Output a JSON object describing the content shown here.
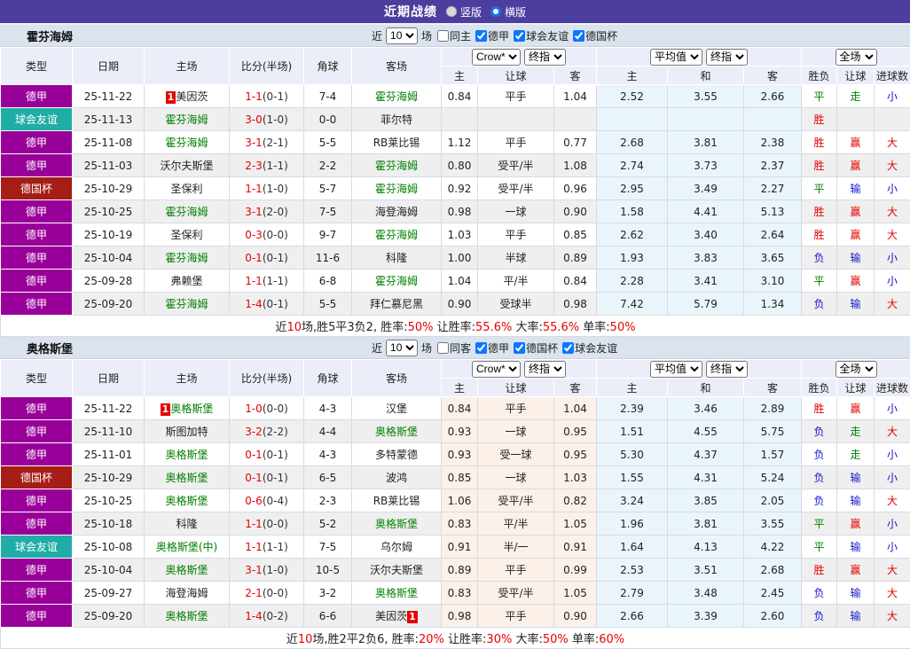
{
  "topbar": {
    "title": "近期战绩",
    "views": [
      {
        "label": "竖版",
        "selected": true
      },
      {
        "label": "横版",
        "selected": false
      }
    ]
  },
  "colors": {
    "topbar_bg": "#4b3e9e",
    "league_type": "#990099",
    "friendly_type": "#1fada6",
    "cup_type": "#a51d15",
    "focal_team": "#008000",
    "score_ft": "#e60000",
    "win": "#e60000",
    "draw": "#008000",
    "lose": "#1414cc",
    "avg_col_bg": "#e9f5fb",
    "odds_col_tint": "#fbf1e9"
  },
  "table_header": {
    "left_cols": [
      "类型",
      "日期",
      "主场",
      "比分(半场)",
      "角球",
      "客场"
    ],
    "odds_group": {
      "selects": [
        "Crow*",
        "终指"
      ],
      "cols": [
        "主",
        "让球",
        "客"
      ]
    },
    "avg_group": {
      "selects": [
        "平均值",
        "终指"
      ],
      "cols": [
        "主",
        "和",
        "客"
      ]
    },
    "result_group": {
      "selects": [
        "全场"
      ],
      "cols": [
        "胜负",
        "让球",
        "进球数"
      ]
    }
  },
  "filter_labels": {
    "prefix": "近",
    "count_value": "10",
    "suffix": "场"
  },
  "sections": [
    {
      "team": "霍芬海姆",
      "odds_tint": false,
      "filters": [
        {
          "label": "同主",
          "checked": false
        },
        {
          "label": "德甲",
          "checked": true
        },
        {
          "label": "球会友谊",
          "checked": true
        },
        {
          "label": "德国杯",
          "checked": true
        }
      ],
      "rows": [
        {
          "type": "德甲",
          "type_class": "league",
          "date": "25-11-22",
          "home": {
            "name": "美因茨",
            "focal": false,
            "badge": "1",
            "badge_pos": "before"
          },
          "score": "1-1",
          "half": "(0-1)",
          "corner": "7-4",
          "away": {
            "name": "霍芬海姆",
            "focal": true
          },
          "odds": [
            "0.84",
            "平手",
            "1.04"
          ],
          "avg": [
            "2.52",
            "3.55",
            "2.66"
          ],
          "results": [
            {
              "t": "平",
              "c": "g"
            },
            {
              "t": "走",
              "c": "g"
            },
            {
              "t": "小",
              "c": "b"
            }
          ]
        },
        {
          "type": "球会友谊",
          "type_class": "friendly",
          "date": "25-11-13",
          "home": {
            "name": "霍芬海姆",
            "focal": true
          },
          "score": "3-0",
          "half": "(1-0)",
          "corner": "0-0",
          "away": {
            "name": "菲尔特",
            "focal": false
          },
          "odds": [
            "",
            "",
            ""
          ],
          "avg": [
            "",
            "",
            ""
          ],
          "results": [
            {
              "t": "胜",
              "c": "r"
            },
            {
              "t": "",
              "c": "k"
            },
            {
              "t": "",
              "c": "k"
            }
          ]
        },
        {
          "type": "德甲",
          "type_class": "league",
          "date": "25-11-08",
          "home": {
            "name": "霍芬海姆",
            "focal": true
          },
          "score": "3-1",
          "half": "(2-1)",
          "corner": "5-5",
          "away": {
            "name": "RB莱比锡",
            "focal": false
          },
          "odds": [
            "1.12",
            "平手",
            "0.77"
          ],
          "avg": [
            "2.68",
            "3.81",
            "2.38"
          ],
          "results": [
            {
              "t": "胜",
              "c": "r"
            },
            {
              "t": "赢",
              "c": "r"
            },
            {
              "t": "大",
              "c": "r"
            }
          ]
        },
        {
          "type": "德甲",
          "type_class": "league",
          "date": "25-11-03",
          "home": {
            "name": "沃尔夫斯堡",
            "focal": false
          },
          "score": "2-3",
          "half": "(1-1)",
          "corner": "2-2",
          "away": {
            "name": "霍芬海姆",
            "focal": true
          },
          "odds": [
            "0.80",
            "受平/半",
            "1.08"
          ],
          "avg": [
            "2.74",
            "3.73",
            "2.37"
          ],
          "results": [
            {
              "t": "胜",
              "c": "r"
            },
            {
              "t": "赢",
              "c": "r"
            },
            {
              "t": "大",
              "c": "r"
            }
          ]
        },
        {
          "type": "德国杯",
          "type_class": "cup",
          "date": "25-10-29",
          "home": {
            "name": "圣保利",
            "focal": false
          },
          "score": "1-1",
          "half": "(1-0)",
          "corner": "5-7",
          "away": {
            "name": "霍芬海姆",
            "focal": true
          },
          "odds": [
            "0.92",
            "受平/半",
            "0.96"
          ],
          "avg": [
            "2.95",
            "3.49",
            "2.27"
          ],
          "results": [
            {
              "t": "平",
              "c": "g"
            },
            {
              "t": "输",
              "c": "b"
            },
            {
              "t": "小",
              "c": "b"
            }
          ]
        },
        {
          "type": "德甲",
          "type_class": "league",
          "date": "25-10-25",
          "home": {
            "name": "霍芬海姆",
            "focal": true
          },
          "score": "3-1",
          "half": "(2-0)",
          "corner": "7-5",
          "away": {
            "name": "海登海姆",
            "focal": false
          },
          "odds": [
            "0.98",
            "一球",
            "0.90"
          ],
          "avg": [
            "1.58",
            "4.41",
            "5.13"
          ],
          "results": [
            {
              "t": "胜",
              "c": "r"
            },
            {
              "t": "赢",
              "c": "r"
            },
            {
              "t": "大",
              "c": "r"
            }
          ]
        },
        {
          "type": "德甲",
          "type_class": "league",
          "date": "25-10-19",
          "home": {
            "name": "圣保利",
            "focal": false
          },
          "score": "0-3",
          "half": "(0-0)",
          "corner": "9-7",
          "away": {
            "name": "霍芬海姆",
            "focal": true
          },
          "odds": [
            "1.03",
            "平手",
            "0.85"
          ],
          "avg": [
            "2.62",
            "3.40",
            "2.64"
          ],
          "results": [
            {
              "t": "胜",
              "c": "r"
            },
            {
              "t": "赢",
              "c": "r"
            },
            {
              "t": "大",
              "c": "r"
            }
          ]
        },
        {
          "type": "德甲",
          "type_class": "league",
          "date": "25-10-04",
          "home": {
            "name": "霍芬海姆",
            "focal": true
          },
          "score": "0-1",
          "half": "(0-1)",
          "corner": "11-6",
          "away": {
            "name": "科隆",
            "focal": false
          },
          "odds": [
            "1.00",
            "半球",
            "0.89"
          ],
          "avg": [
            "1.93",
            "3.83",
            "3.65"
          ],
          "results": [
            {
              "t": "负",
              "c": "b"
            },
            {
              "t": "输",
              "c": "b"
            },
            {
              "t": "小",
              "c": "b"
            }
          ]
        },
        {
          "type": "德甲",
          "type_class": "league",
          "date": "25-09-28",
          "home": {
            "name": "弗赖堡",
            "focal": false
          },
          "score": "1-1",
          "half": "(1-1)",
          "corner": "6-8",
          "away": {
            "name": "霍芬海姆",
            "focal": true
          },
          "odds": [
            "1.04",
            "平/半",
            "0.84"
          ],
          "avg": [
            "2.28",
            "3.41",
            "3.10"
          ],
          "results": [
            {
              "t": "平",
              "c": "g"
            },
            {
              "t": "赢",
              "c": "r"
            },
            {
              "t": "小",
              "c": "b"
            }
          ]
        },
        {
          "type": "德甲",
          "type_class": "league",
          "date": "25-09-20",
          "home": {
            "name": "霍芬海姆",
            "focal": true
          },
          "score": "1-4",
          "half": "(0-1)",
          "corner": "5-5",
          "away": {
            "name": "拜仁慕尼黑",
            "focal": false
          },
          "odds": [
            "0.90",
            "受球半",
            "0.98"
          ],
          "avg": [
            "7.42",
            "5.79",
            "1.34"
          ],
          "results": [
            {
              "t": "负",
              "c": "b"
            },
            {
              "t": "输",
              "c": "b"
            },
            {
              "t": "大",
              "c": "r"
            }
          ]
        }
      ],
      "summary": [
        [
          "近",
          "k"
        ],
        [
          "10",
          "r"
        ],
        [
          "场,胜5平3负2, 胜率:",
          "k"
        ],
        [
          "50%",
          "r"
        ],
        [
          " 让胜率:",
          "k"
        ],
        [
          "55.6%",
          "r"
        ],
        [
          " 大率:",
          "k"
        ],
        [
          "55.6%",
          "r"
        ],
        [
          " 单率:",
          "k"
        ],
        [
          "50%",
          "r"
        ]
      ]
    },
    {
      "team": "奥格斯堡",
      "odds_tint": true,
      "filters": [
        {
          "label": "同客",
          "checked": false
        },
        {
          "label": "德甲",
          "checked": true
        },
        {
          "label": "德国杯",
          "checked": true
        },
        {
          "label": "球会友谊",
          "checked": true
        }
      ],
      "rows": [
        {
          "type": "德甲",
          "type_class": "league",
          "date": "25-11-22",
          "home": {
            "name": "奥格斯堡",
            "focal": true,
            "badge": "1",
            "badge_pos": "before"
          },
          "score": "1-0",
          "half": "(0-0)",
          "corner": "4-3",
          "away": {
            "name": "汉堡",
            "focal": false
          },
          "odds": [
            "0.84",
            "平手",
            "1.04"
          ],
          "avg": [
            "2.39",
            "3.46",
            "2.89"
          ],
          "results": [
            {
              "t": "胜",
              "c": "r"
            },
            {
              "t": "赢",
              "c": "r"
            },
            {
              "t": "小",
              "c": "b"
            }
          ]
        },
        {
          "type": "德甲",
          "type_class": "league",
          "date": "25-11-10",
          "home": {
            "name": "斯图加特",
            "focal": false
          },
          "score": "3-2",
          "half": "(2-2)",
          "corner": "4-4",
          "away": {
            "name": "奥格斯堡",
            "focal": true
          },
          "odds": [
            "0.93",
            "一球",
            "0.95"
          ],
          "avg": [
            "1.51",
            "4.55",
            "5.75"
          ],
          "results": [
            {
              "t": "负",
              "c": "b"
            },
            {
              "t": "走",
              "c": "g"
            },
            {
              "t": "大",
              "c": "r"
            }
          ]
        },
        {
          "type": "德甲",
          "type_class": "league",
          "date": "25-11-01",
          "home": {
            "name": "奥格斯堡",
            "focal": true
          },
          "score": "0-1",
          "half": "(0-1)",
          "corner": "4-3",
          "away": {
            "name": "多特蒙德",
            "focal": false
          },
          "odds": [
            "0.93",
            "受一球",
            "0.95"
          ],
          "avg": [
            "5.30",
            "4.37",
            "1.57"
          ],
          "results": [
            {
              "t": "负",
              "c": "b"
            },
            {
              "t": "走",
              "c": "g"
            },
            {
              "t": "小",
              "c": "b"
            }
          ]
        },
        {
          "type": "德国杯",
          "type_class": "cup",
          "date": "25-10-29",
          "home": {
            "name": "奥格斯堡",
            "focal": true
          },
          "score": "0-1",
          "half": "(0-1)",
          "corner": "6-5",
          "away": {
            "name": "波鸿",
            "focal": false
          },
          "odds": [
            "0.85",
            "一球",
            "1.03"
          ],
          "avg": [
            "1.55",
            "4.31",
            "5.24"
          ],
          "results": [
            {
              "t": "负",
              "c": "b"
            },
            {
              "t": "输",
              "c": "b"
            },
            {
              "t": "小",
              "c": "b"
            }
          ]
        },
        {
          "type": "德甲",
          "type_class": "league",
          "date": "25-10-25",
          "home": {
            "name": "奥格斯堡",
            "focal": true
          },
          "score": "0-6",
          "half": "(0-4)",
          "corner": "2-3",
          "away": {
            "name": "RB莱比锡",
            "focal": false
          },
          "odds": [
            "1.06",
            "受平/半",
            "0.82"
          ],
          "avg": [
            "3.24",
            "3.85",
            "2.05"
          ],
          "results": [
            {
              "t": "负",
              "c": "b"
            },
            {
              "t": "输",
              "c": "b"
            },
            {
              "t": "大",
              "c": "r"
            }
          ]
        },
        {
          "type": "德甲",
          "type_class": "league",
          "date": "25-10-18",
          "home": {
            "name": "科隆",
            "focal": false
          },
          "score": "1-1",
          "half": "(0-0)",
          "corner": "5-2",
          "away": {
            "name": "奥格斯堡",
            "focal": true
          },
          "odds": [
            "0.83",
            "平/半",
            "1.05"
          ],
          "avg": [
            "1.96",
            "3.81",
            "3.55"
          ],
          "results": [
            {
              "t": "平",
              "c": "g"
            },
            {
              "t": "赢",
              "c": "r"
            },
            {
              "t": "小",
              "c": "b"
            }
          ]
        },
        {
          "type": "球会友谊",
          "type_class": "friendly",
          "date": "25-10-08",
          "home": {
            "name": "奥格斯堡(中)",
            "focal": true
          },
          "score": "1-1",
          "half": "(1-1)",
          "corner": "7-5",
          "away": {
            "name": "乌尔姆",
            "focal": false
          },
          "odds": [
            "0.91",
            "半/一",
            "0.91"
          ],
          "avg": [
            "1.64",
            "4.13",
            "4.22"
          ],
          "results": [
            {
              "t": "平",
              "c": "g"
            },
            {
              "t": "输",
              "c": "b"
            },
            {
              "t": "小",
              "c": "b"
            }
          ]
        },
        {
          "type": "德甲",
          "type_class": "league",
          "date": "25-10-04",
          "home": {
            "name": "奥格斯堡",
            "focal": true
          },
          "score": "3-1",
          "half": "(1-0)",
          "corner": "10-5",
          "away": {
            "name": "沃尔夫斯堡",
            "focal": false
          },
          "odds": [
            "0.89",
            "平手",
            "0.99"
          ],
          "avg": [
            "2.53",
            "3.51",
            "2.68"
          ],
          "results": [
            {
              "t": "胜",
              "c": "r"
            },
            {
              "t": "赢",
              "c": "r"
            },
            {
              "t": "大",
              "c": "r"
            }
          ]
        },
        {
          "type": "德甲",
          "type_class": "league",
          "date": "25-09-27",
          "home": {
            "name": "海登海姆",
            "focal": false
          },
          "score": "2-1",
          "half": "(0-0)",
          "corner": "3-2",
          "away": {
            "name": "奥格斯堡",
            "focal": true
          },
          "odds": [
            "0.83",
            "受平/半",
            "1.05"
          ],
          "avg": [
            "2.79",
            "3.48",
            "2.45"
          ],
          "results": [
            {
              "t": "负",
              "c": "b"
            },
            {
              "t": "输",
              "c": "b"
            },
            {
              "t": "大",
              "c": "r"
            }
          ]
        },
        {
          "type": "德甲",
          "type_class": "league",
          "date": "25-09-20",
          "home": {
            "name": "奥格斯堡",
            "focal": true
          },
          "score": "1-4",
          "half": "(0-2)",
          "corner": "6-6",
          "away": {
            "name": "美因茨",
            "focal": false,
            "badge": "1",
            "badge_pos": "after"
          },
          "odds": [
            "0.98",
            "平手",
            "0.90"
          ],
          "avg": [
            "2.66",
            "3.39",
            "2.60"
          ],
          "results": [
            {
              "t": "负",
              "c": "b"
            },
            {
              "t": "输",
              "c": "b"
            },
            {
              "t": "大",
              "c": "r"
            }
          ]
        }
      ],
      "summary": [
        [
          "近",
          "k"
        ],
        [
          "10",
          "r"
        ],
        [
          "场,胜2平2负6, 胜率:",
          "k"
        ],
        [
          "20%",
          "r"
        ],
        [
          " 让胜率:",
          "k"
        ],
        [
          "30%",
          "r"
        ],
        [
          " 大率:",
          "k"
        ],
        [
          "50%",
          "r"
        ],
        [
          " 单率:",
          "k"
        ],
        [
          "60%",
          "r"
        ]
      ]
    }
  ]
}
